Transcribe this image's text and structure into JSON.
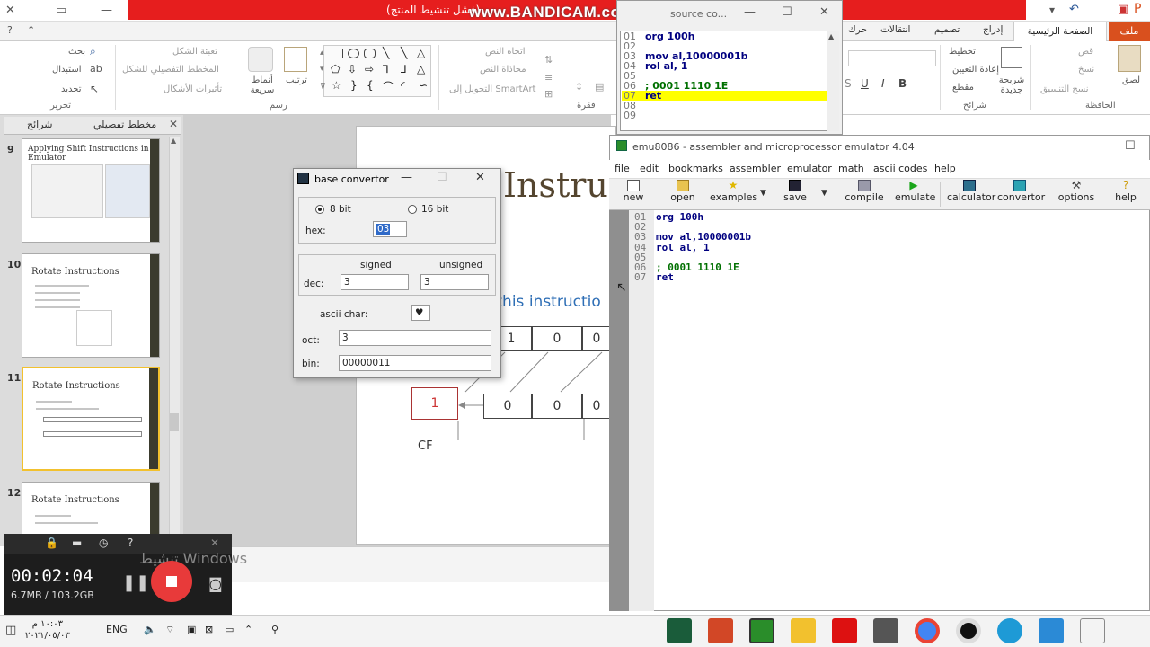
{
  "titlebar": {
    "title_text": "(فشل تنشيط المنتج)",
    "watermark": "www.BANDICAM.com"
  },
  "ribbon": {
    "file_tab": "ملف",
    "tabs": [
      "الصفحة الرئيسية",
      "إدراج",
      "تصميم",
      "انتقالات",
      "حركات"
    ],
    "clipboard": {
      "paste": "لصق",
      "cut": "قص",
      "copy": "نسخ",
      "format_painter": "نسخ التنسيق",
      "label": "الحافظة"
    },
    "slides": {
      "new_slide": "شريحة جديدة",
      "layout": "تخطيط",
      "reset": "إعادة التعيين",
      "section": "مقطع",
      "label": "شرائح"
    },
    "font_buttons": {
      "bold": "B",
      "italic": "I",
      "underline": "U",
      "shadow": "S"
    },
    "paragraph": {
      "text_direction": "اتجاه النص",
      "align_text": "محاذاة النص",
      "smartart": "التحويل إلى SmartArt",
      "label": "فقرة"
    },
    "drawing": {
      "arrange": "ترتيب",
      "quick_styles": "أنماط سريعة",
      "shape_fill": "تعبئة الشكل",
      "shape_outline": "المخطط التفصيلي للشكل",
      "shape_effects": "تأثيرات الأشكال",
      "label": "رسم"
    },
    "editing": {
      "find": "بحث",
      "replace": "استبدال",
      "select": "تحديد",
      "label": "تحرير"
    }
  },
  "slide_panel": {
    "tabs": [
      "شرائح",
      "مخطط تفصيلي"
    ],
    "thumbnails": [
      {
        "num": "9",
        "title": "Applying Shift Instructions in Emulator"
      },
      {
        "num": "10",
        "title": "Rotate Instructions"
      },
      {
        "num": "11",
        "title": "Rotate Instructions"
      },
      {
        "num": "12",
        "title": "Rotate Instructions"
      }
    ]
  },
  "slide": {
    "title": "Instruc",
    "subtitle": "r this instructio",
    "row1": [
      "1",
      "0",
      "0"
    ],
    "row2": [
      "0",
      "0",
      "0"
    ],
    "cf_value": "1",
    "cf_label": "CF"
  },
  "source_window": {
    "title": "source co...",
    "lines": [
      {
        "n": "01",
        "text": "org 100h",
        "type": "kw"
      },
      {
        "n": "02",
        "text": "",
        "type": "kw"
      },
      {
        "n": "03",
        "text": "mov al,10000001b",
        "type": "kw"
      },
      {
        "n": "04",
        "text": "rol al, 1",
        "type": "kw"
      },
      {
        "n": "05",
        "text": "",
        "type": "kw"
      },
      {
        "n": "06",
        "text": "; 0001 1110 1E",
        "type": "cm"
      },
      {
        "n": "07",
        "text": "ret",
        "type": "hl"
      },
      {
        "n": "08",
        "text": "",
        "type": "kw"
      },
      {
        "n": "09",
        "text": "",
        "type": "kw"
      }
    ]
  },
  "emu": {
    "title": "emu8086 - assembler and microprocessor emulator 4.04",
    "menu": [
      "file",
      "edit",
      "bookmarks",
      "assembler",
      "emulator",
      "math",
      "ascii codes",
      "help"
    ],
    "toolbar": [
      "new",
      "open",
      "examples",
      "save",
      "compile",
      "emulate",
      "calculator",
      "convertor",
      "options",
      "help"
    ],
    "lines": [
      {
        "n": "01",
        "text": "org 100h",
        "type": "kw"
      },
      {
        "n": "02",
        "text": "",
        "type": "kw"
      },
      {
        "n": "03",
        "text": "mov al,10000001b",
        "type": "kw"
      },
      {
        "n": "04",
        "text": "rol al, 1",
        "type": "kw"
      },
      {
        "n": "05",
        "text": "",
        "type": "kw"
      },
      {
        "n": "06",
        "text": "; 0001 1110 1E",
        "type": "cm"
      },
      {
        "n": "07",
        "text": "ret",
        "type": "kw"
      }
    ]
  },
  "convertor": {
    "title": "base convertor",
    "bit8": "8 bit",
    "bit16": "16 bit",
    "hex_label": "hex:",
    "hex_value": "03",
    "signed_label": "signed",
    "unsigned_label": "unsigned",
    "dec_label": "dec:",
    "dec_signed": "3",
    "dec_unsigned": "3",
    "ascii_label": "ascii char:",
    "ascii_value": "♥",
    "oct_label": "oct:",
    "oct_value": "3",
    "bin_label": "bin:",
    "bin_value": "00000011"
  },
  "recorder": {
    "time": "00:02:04",
    "size": "6.7MB / 103.2GB"
  },
  "activation": "تنشيط Windows",
  "taskbar": {
    "lang": "ENG",
    "time": "١٠:٠٣ م",
    "date": "٢٠٢١/٠٥/٠٣"
  }
}
